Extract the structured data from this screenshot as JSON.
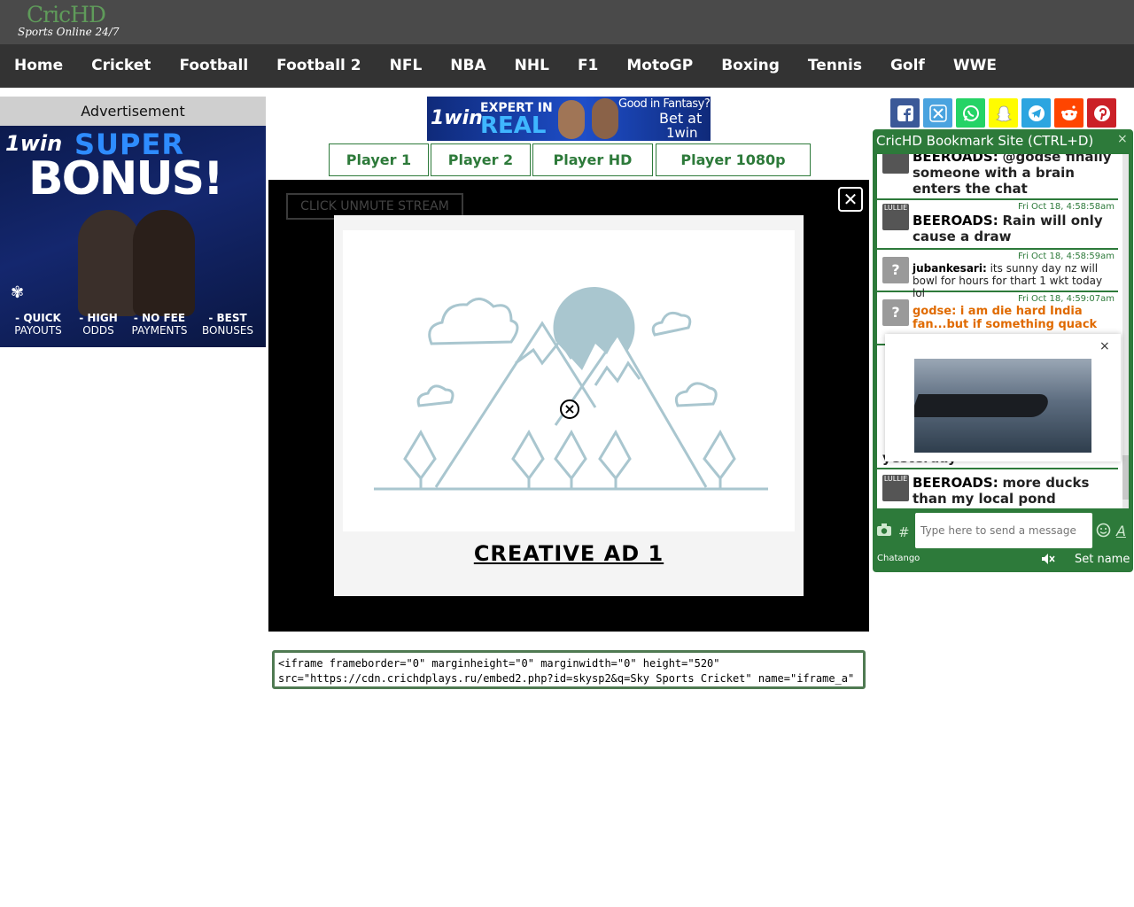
{
  "header": {
    "logo_main": "CricHD",
    "logo_sub": "Sports Online 24/7"
  },
  "nav": {
    "items": [
      "Home",
      "Cricket",
      "Football",
      "Football 2",
      "NFL",
      "NBA",
      "NHL",
      "F1",
      "MotoGP",
      "Boxing",
      "Tennis",
      "Golf",
      "WWE"
    ]
  },
  "left_ad": {
    "title": "Advertisement",
    "brand": "1win",
    "headline_1": "SUPER",
    "headline_2": "BONUS!",
    "features": [
      {
        "line1": "- QUICK",
        "line2": "PAYOUTS"
      },
      {
        "line1": "- HIGH",
        "line2": "ODDS"
      },
      {
        "line1": "- NO FEE",
        "line2": "PAYMENTS"
      },
      {
        "line1": "- BEST",
        "line2": "BONUSES"
      }
    ]
  },
  "top_banner": {
    "brand": "1win",
    "line1": "EXPERT IN",
    "line2": "REAL",
    "tag1": "Good in Fantasy?",
    "tag2": "Bet at",
    "tag3": "1win"
  },
  "players": [
    "Player 1",
    "Player 2",
    "Player HD",
    "Player 1080p"
  ],
  "video": {
    "unmute_label": "CLICK UNMUTE STREAM",
    "close_symbol": "✕",
    "ad_label": "CREATIVE AD 1"
  },
  "embed_code": {
    "line1": "<iframe frameborder=\"0\" marginheight=\"0\" marginwidth=\"0\" height=\"520\"",
    "line2": "src=\"https://cdn.crichdplays.ru/embed2.php?id=skysp2&q=Sky Sports Cricket\" name=\"iframe_a\""
  },
  "share": {
    "icons": [
      {
        "name": "facebook-icon",
        "color": "#3b5998"
      },
      {
        "name": "x-icon",
        "color": "#1da1f2"
      },
      {
        "name": "whatsapp-icon",
        "color": "#25d366"
      },
      {
        "name": "snapchat-icon",
        "color": "#fffc00"
      },
      {
        "name": "telegram-icon",
        "color": "#2ca5e0"
      },
      {
        "name": "reddit-icon",
        "color": "#ff4500"
      },
      {
        "name": "pinterest-icon",
        "color": "#cb2027"
      }
    ]
  },
  "chat": {
    "title": "CricHD Bookmark Site (CTRL+D)",
    "minimize": "×",
    "messages": [
      {
        "user": "BEEROADS:",
        "text": "@godse finally someone with a brain enters the chat",
        "time": ""
      },
      {
        "user": "BEEROADS:",
        "text": "Rain will only cause a draw",
        "time": "Fri Oct 18, 4:58:58am"
      },
      {
        "user": "jubankesari:",
        "text": "its sunny day nz will bowl for hours for thart 1 wkt today lol",
        "time": "Fri Oct 18, 4:58:59am"
      },
      {
        "user": "godse:",
        "text": "i am die hard India fan...but if something quack",
        "time": "Fri Oct 18, 4:59:07am"
      },
      {
        "user": "",
        "text": "yesterday",
        "time": ""
      },
      {
        "user": "BEEROADS:",
        "text": "more ducks than my local pond",
        "time": ""
      }
    ],
    "avatar_text": "LULLIE",
    "unknown_avatar": "?",
    "popup_close": "×",
    "input_placeholder": "Type here to send a message",
    "brand": "Chatango",
    "set_name": "Set name",
    "hash": "#"
  },
  "colors": {
    "nav_bg": "#333333",
    "header_bg": "#4a4a4a",
    "accent_green": "#2d7a3a"
  }
}
